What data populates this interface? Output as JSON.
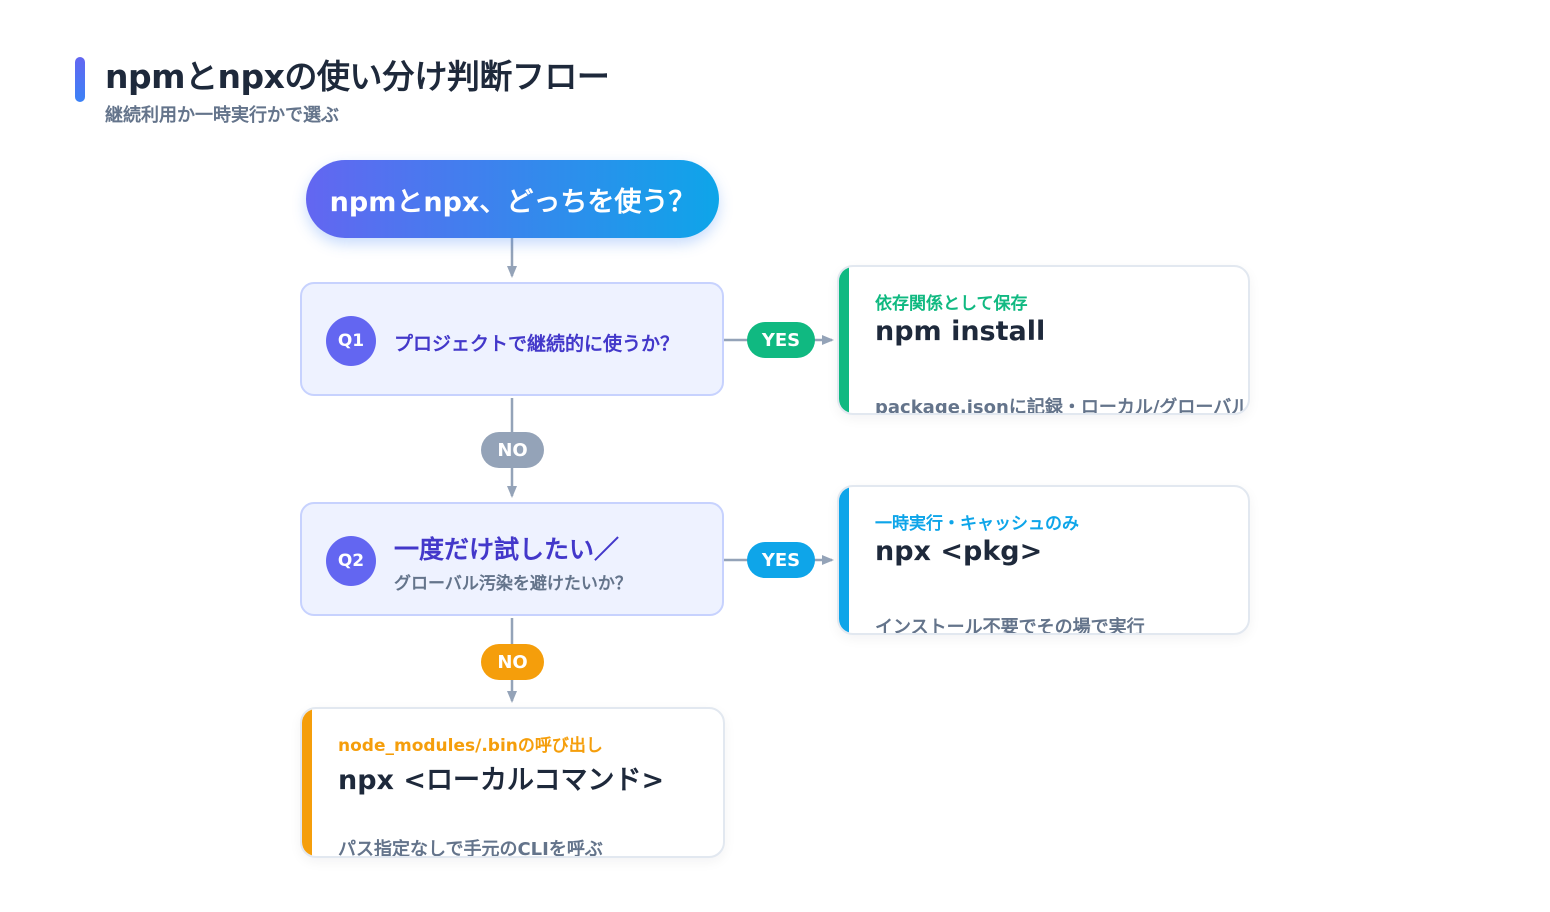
{
  "header": {
    "title": "npmとnpxの使い分け判断フロー",
    "subtitle": "継続利用か一時実行かで選ぶ"
  },
  "start": {
    "label": "npmとnpx、どっちを使う？"
  },
  "q1": {
    "badge": "Q1",
    "text": "プロジェクトで継続的に使うか？",
    "yes_label": "YES",
    "no_label": "NO"
  },
  "q2": {
    "badge": "Q2",
    "text_line1": "一度だけ試したい／",
    "text_line2": "グローバル汚染を避けたいか？",
    "yes_label": "YES",
    "no_label": "NO"
  },
  "results": {
    "npm_install": {
      "tag": "依存関係として保存",
      "command": "npm install",
      "note": "package.jsonに記録・ローカル/グローバル",
      "color": "#10b981"
    },
    "npx_pkg": {
      "tag": "一時実行・キャッシュのみ",
      "command": "npx <pkg>",
      "note": "インストール不要でその場で実行",
      "color": "#0ea5e9"
    },
    "npx_local": {
      "tag": "node_modules/.binの呼び出し",
      "command": "npx <ローカルコマンド>",
      "note": "パス指定なしで手元のCLIを呼ぶ",
      "color": "#f59e0b"
    }
  },
  "colors": {
    "accent": "#6366f1",
    "yes": "#10b981",
    "yes_q2": "#0ea5e9",
    "no_q1": "#94a3b8",
    "no_q2": "#f59e0b",
    "connector": "#94a3b8"
  }
}
